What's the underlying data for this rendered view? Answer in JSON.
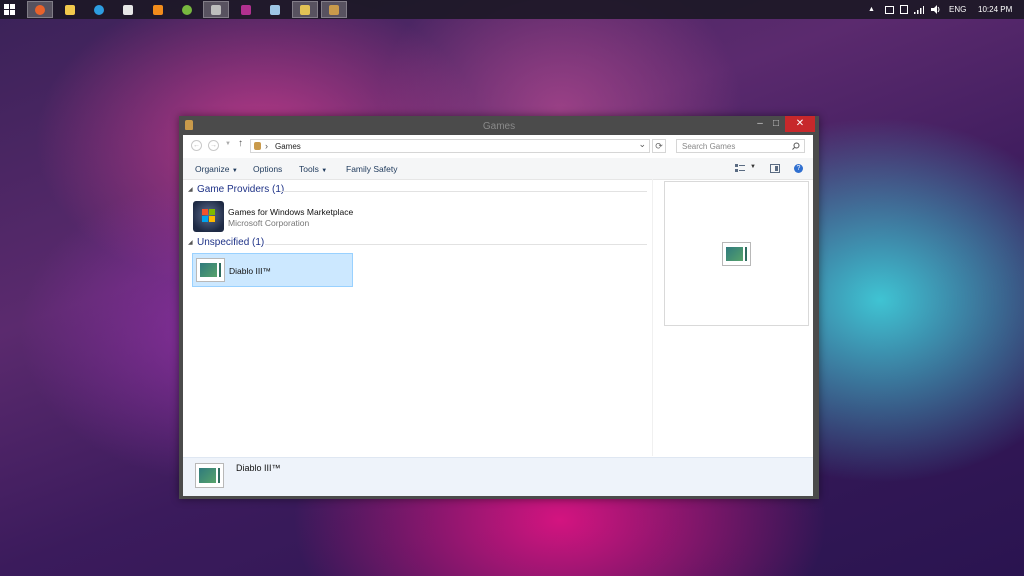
{
  "taskbar": {
    "apps": [
      {
        "icon": "firefox-icon",
        "color": "#e8622b"
      },
      {
        "icon": "file-explorer-icon",
        "color": "#f2c94c"
      },
      {
        "icon": "browser-icon",
        "color": "#2d9de1"
      },
      {
        "icon": "alien-icon",
        "color": "#e6e6e6"
      },
      {
        "icon": "vlc-icon",
        "color": "#f28c1b"
      },
      {
        "icon": "utorrent-icon",
        "color": "#78b83f"
      },
      {
        "icon": "terminal-icon",
        "color": "#bdbdbd"
      },
      {
        "icon": "onenote-icon",
        "color": "#b0308f"
      },
      {
        "icon": "notepad-icon",
        "color": "#9ec6e6"
      },
      {
        "icon": "photos-icon",
        "color": "#e3c255"
      },
      {
        "icon": "games-icon",
        "color": "#c99a4b"
      }
    ],
    "tray": {
      "language": "ENG",
      "time": "10:24 PM"
    }
  },
  "window": {
    "title": "Games",
    "minimize_glyph": "–",
    "maximize_glyph": "□",
    "close_glyph": "✕"
  },
  "address": {
    "separator": "›",
    "path": "Games",
    "dropdown": "⌄",
    "refresh": "⟳",
    "search_placeholder": "Search Games"
  },
  "toolbar": {
    "organize": "Organize",
    "options": "Options",
    "tools": "Tools",
    "family_safety": "Family Safety"
  },
  "groups": [
    {
      "title": "Game Providers (1)",
      "items": [
        {
          "name": "Games for Windows Marketplace",
          "publisher": "Microsoft Corporation"
        }
      ]
    },
    {
      "title": "Unspecified (1)",
      "items": [
        {
          "name": "Diablo III™"
        }
      ]
    }
  ],
  "details_pane": {
    "name": "Diablo III™"
  },
  "colors": {
    "accent": "#1e3287",
    "selection": "#cce8ff",
    "close": "#c7282b"
  }
}
